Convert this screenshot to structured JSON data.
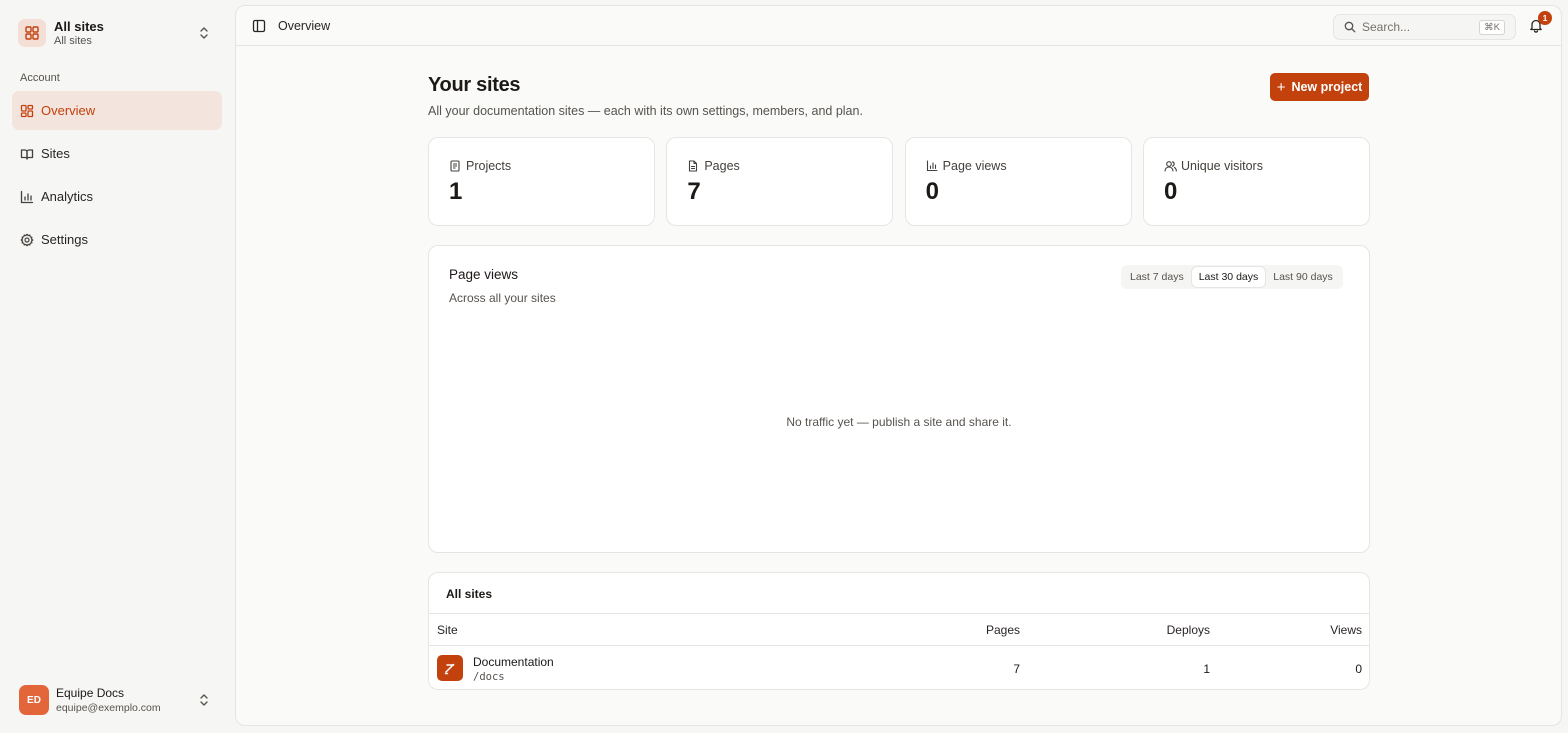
{
  "sidebar": {
    "switcher": {
      "title": "All sites",
      "subtitle": "All sites"
    },
    "section_label": "Account",
    "items": [
      {
        "label": "Overview",
        "icon": "layout-grid-icon",
        "active": true
      },
      {
        "label": "Sites",
        "icon": "book-open-icon",
        "active": false
      },
      {
        "label": "Analytics",
        "icon": "bar-chart-icon",
        "active": false
      },
      {
        "label": "Settings",
        "icon": "gear-icon",
        "active": false
      }
    ],
    "user": {
      "initials": "ED",
      "name": "Equipe Docs",
      "email": "equipe@exemplo.com"
    }
  },
  "topbar": {
    "breadcrumb": "Overview",
    "search_placeholder": "Search...",
    "search_shortcut": "⌘K",
    "notification_count": "1"
  },
  "page": {
    "title": "Your sites",
    "subtitle": "All your documentation sites — each with its own settings, members, and plan.",
    "new_button": "New project"
  },
  "stats": [
    {
      "label": "Projects",
      "value": "1",
      "icon": "file-icon"
    },
    {
      "label": "Pages",
      "value": "7",
      "icon": "document-icon"
    },
    {
      "label": "Page views",
      "value": "0",
      "icon": "bar-chart-icon"
    },
    {
      "label": "Unique visitors",
      "value": "0",
      "icon": "users-icon"
    }
  ],
  "chart_card": {
    "title": "Page views",
    "subtitle": "Across all your sites",
    "ranges": [
      "Last 7 days",
      "Last 30 days",
      "Last 90 days"
    ],
    "selected_range": "Last 30 days",
    "empty_message": "No traffic yet — publish a site and share it."
  },
  "sites_table": {
    "title": "All sites",
    "columns": [
      "Site",
      "Pages",
      "Deploys",
      "Views"
    ],
    "rows": [
      {
        "name": "Documentation",
        "path": "/docs",
        "pages": "7",
        "deploys": "1",
        "views": "0"
      }
    ]
  },
  "colors": {
    "accent": "#c2410c",
    "accent_soft": "#f4e4de",
    "background": "#f6f6f5"
  }
}
